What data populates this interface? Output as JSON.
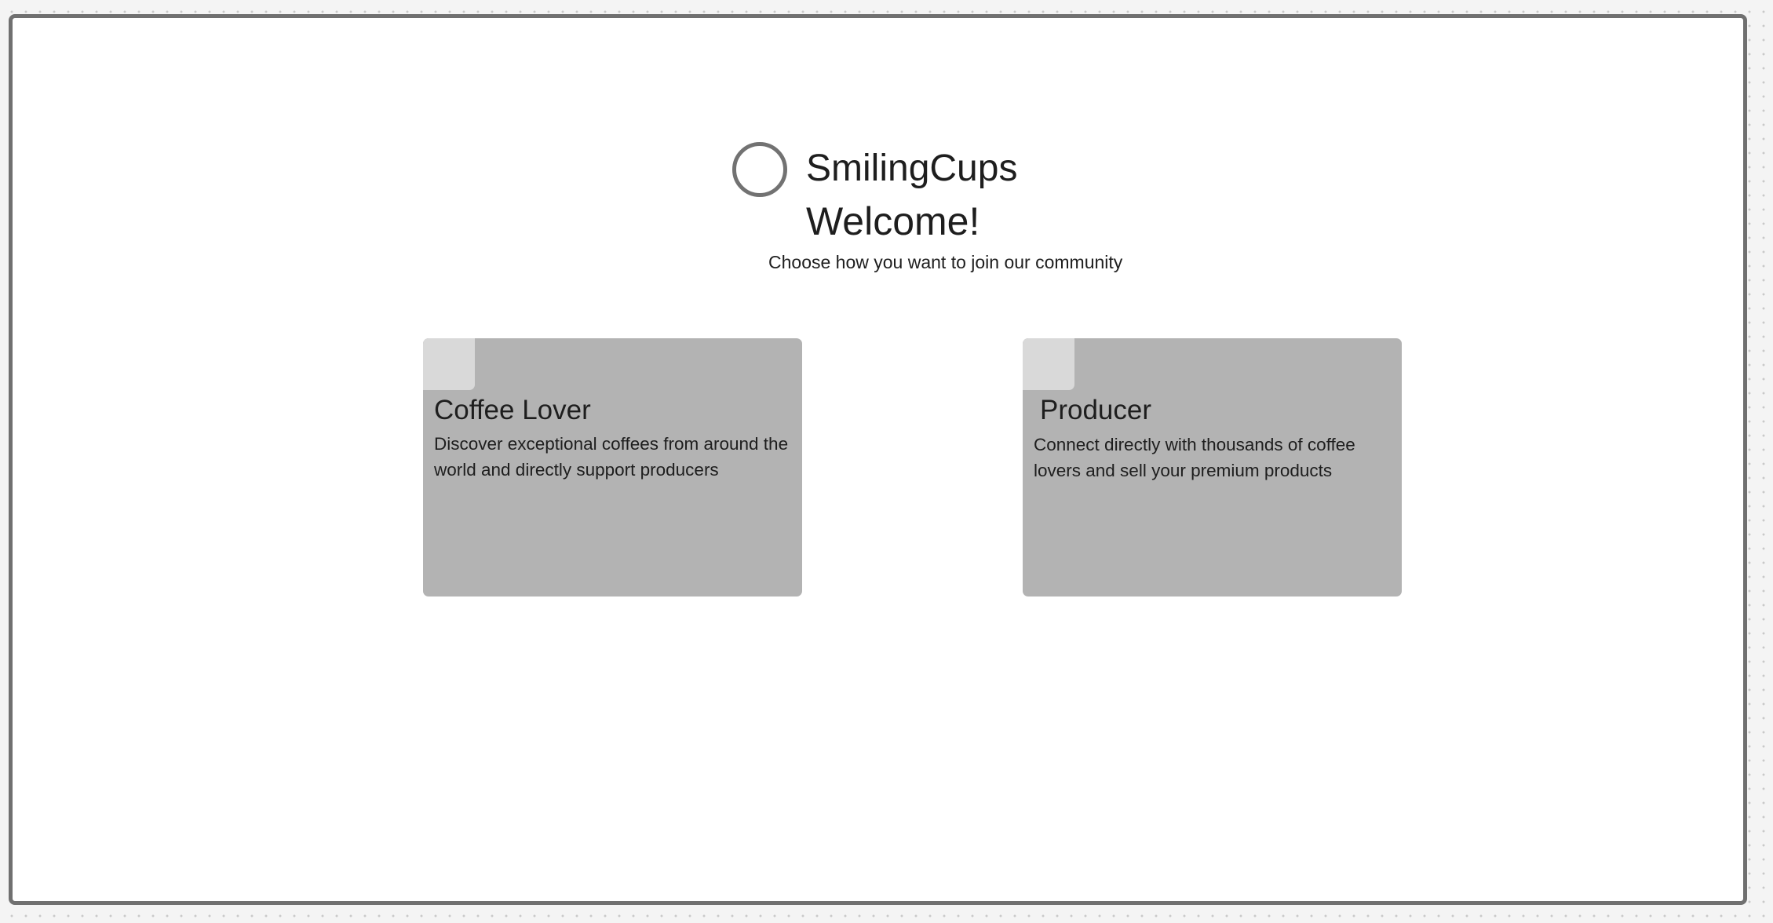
{
  "header": {
    "brand_name": "SmilingCups",
    "logo_icon": "circle-logo-icon",
    "title": "Welcome!",
    "subtitle": "Choose how you want to join our community"
  },
  "cards": [
    {
      "id": "coffee-lover",
      "icon": "image-placeholder-icon",
      "title": "Coffee Lover",
      "description": "Discover exceptional coffees from around the world and directly support producers"
    },
    {
      "id": "producer",
      "icon": "image-placeholder-icon",
      "title": "Producer",
      "description": "Connect directly with thousands of coffee lovers and sell your premium products"
    }
  ],
  "colors": {
    "frame_border": "#707070",
    "card_background": "#b3b3b3",
    "card_icon_background": "#d9d9d9",
    "text": "#1e1e1e",
    "canvas_background": "#f4f4f4"
  }
}
